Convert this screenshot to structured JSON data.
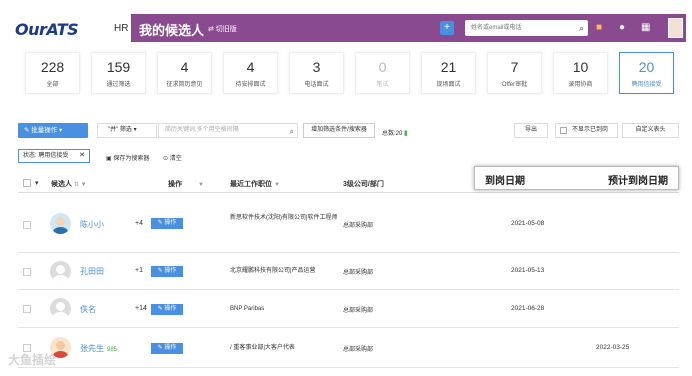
{
  "header": {
    "logo": "OurATS",
    "hr_label": "HR",
    "title": "我的候选人",
    "switch_label": "⇄ 切旧版",
    "add_label": "+",
    "search_placeholder": "姓名或email或电话"
  },
  "stats": [
    {
      "count": "228",
      "label": "全部"
    },
    {
      "count": "159",
      "label": "通过筛选"
    },
    {
      "count": "4",
      "label": "征求简历意见"
    },
    {
      "count": "4",
      "label": "待安排面试"
    },
    {
      "count": "3",
      "label": "电话面试"
    },
    {
      "count": "0",
      "label": "笔试"
    },
    {
      "count": "21",
      "label": "现场面试"
    },
    {
      "count": "7",
      "label": "Offer审批"
    },
    {
      "count": "10",
      "label": "录用协商"
    },
    {
      "count": "20",
      "label": "聘用信接受"
    }
  ],
  "toolbar": {
    "bulk_label": "✎ 批量操作 ▾",
    "filter_label": "\"并\" 筛选 ▾",
    "keyword_placeholder": "简历关键词,多个用空格间隔",
    "add_condition": "增加筛选条件/搜索器",
    "total_label": "总数:20",
    "export_label": "导出",
    "hide_joined": "不显示已到岗",
    "custom_columns": "自定义表头"
  },
  "filter_tag": "状态: 聘用信接受",
  "save_search": "保存为搜索器",
  "clear_label": "清空",
  "columns": {
    "candidate": "候选人",
    "action": "操作",
    "last_job": "最近工作职位",
    "dept": "3级公司/部门"
  },
  "highlight": {
    "arrival": "到岗日期",
    "expected": "预计到岗日期"
  },
  "rows": [
    {
      "name": "陈小小",
      "tag": "",
      "count": "+4",
      "op": "操作",
      "job": "新思软件技术(沈阳)有限公司|软件工程师",
      "dept": "总部采购部",
      "date": "2021-05-08",
      "pdate": ""
    },
    {
      "name": "孔田田",
      "tag": "",
      "count": "+1",
      "op": "操作",
      "job": "北京耀鹏科技有限公司|产品运营",
      "dept": "总部采购部",
      "date": "2021-05-13",
      "pdate": ""
    },
    {
      "name": "佚名",
      "tag": "",
      "count": "+14",
      "op": "操作",
      "job": "BNP Paribas",
      "dept": "总部采购部",
      "date": "2021-06-28",
      "pdate": ""
    },
    {
      "name": "张先生",
      "tag": "985",
      "count": "",
      "op": "操作",
      "job": "/ 重客事业部|大客户代表",
      "dept": "总部采购部",
      "date": "",
      "pdate": "2022-03-25"
    }
  ],
  "watermark": "大鱼插绘"
}
